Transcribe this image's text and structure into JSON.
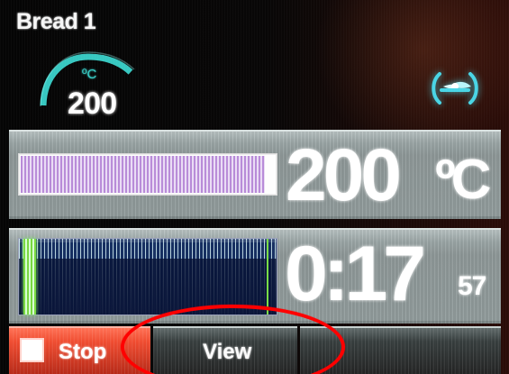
{
  "screen": {
    "program_title": "Bread 1"
  },
  "setpoint": {
    "unit": "ºC",
    "value": "200",
    "dial_color": "#39d0c9"
  },
  "fan": {
    "icon": "fan-icon",
    "color": "#49d5e5"
  },
  "temperature": {
    "value": "200",
    "unit": "ºC",
    "progress_fraction": 0.96,
    "bar_colors": {
      "primary": "#b88bd8",
      "secondary": "#eadcf5"
    }
  },
  "timer": {
    "main": "0:17",
    "seconds": "57",
    "elapsed_fraction": 0.05,
    "progress_color": "#78d840"
  },
  "buttons": {
    "stop": {
      "label": "Stop",
      "icon": "stop-square-icon"
    },
    "view": {
      "label": "View"
    }
  },
  "annotation": {
    "color": "#ff0000"
  }
}
